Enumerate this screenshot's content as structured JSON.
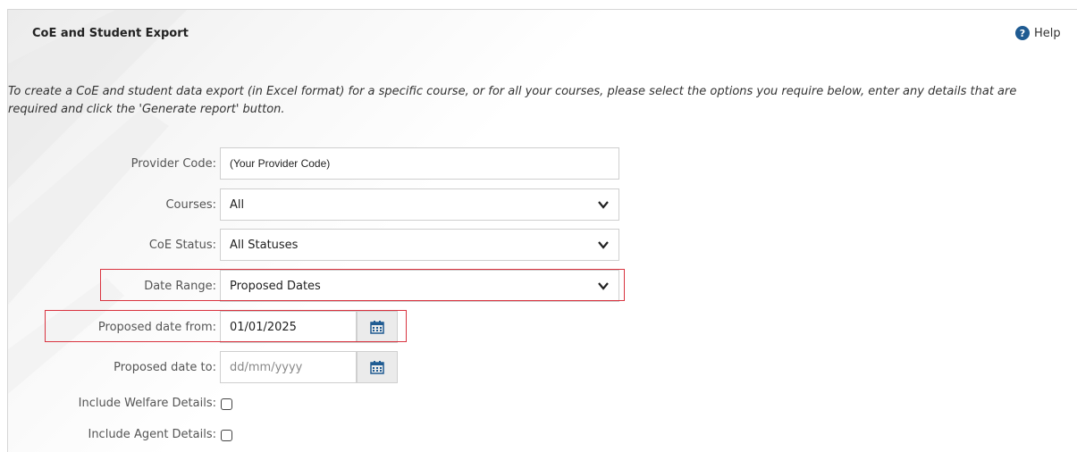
{
  "header": {
    "title": "CoE and Student Export",
    "help_label": "Help",
    "help_icon": "question-circle-icon"
  },
  "intro_text": "To create a CoE and student data export (in Excel format) for a specific course, or for all your courses, please select the options you require below, enter any details that are required and click the 'Generate report' button.",
  "form": {
    "provider_code": {
      "label": "Provider Code:",
      "value": "(Your Provider Code)"
    },
    "courses": {
      "label": "Courses:",
      "selected": "All"
    },
    "coe_status": {
      "label": "CoE Status:",
      "selected": "All Statuses"
    },
    "date_range": {
      "label": "Date Range:",
      "selected": "Proposed Dates"
    },
    "proposed_from": {
      "label": "Proposed date from:",
      "value": "01/01/2025"
    },
    "proposed_to": {
      "label": "Proposed date to:",
      "placeholder": "dd/mm/yyyy"
    },
    "include_welfare": {
      "label": "Include Welfare Details:",
      "checked": false
    },
    "include_agent": {
      "label": "Include Agent Details:",
      "checked": false
    }
  },
  "colors": {
    "highlight": "#d9333f",
    "help_icon": "#1f5b92",
    "calendar_icon": "#1f5b92"
  }
}
